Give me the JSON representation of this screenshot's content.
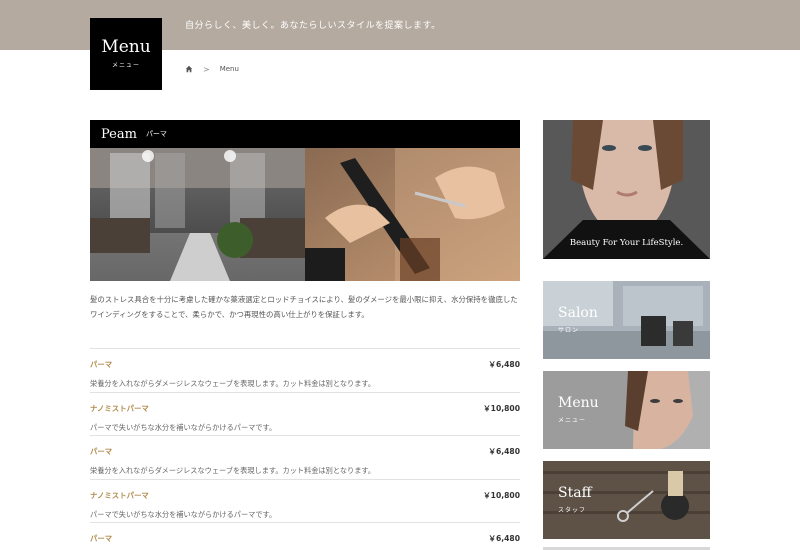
{
  "header": {
    "tagline": "自分らしく、美しく。あなたらしいスタイルを提案します。",
    "logo_main": "Menu",
    "logo_sub": "メニュー"
  },
  "breadcrumb": {
    "current": "Menu",
    "separator": ">",
    "home_icon": "home-icon"
  },
  "section": {
    "title": "Peam",
    "subtitle": "パーマ",
    "intro": "髪のストレス具合を十分に考慮した確かな薬液選定とロッドチョイスにより、髪のダメージを最小限に抑え、水分保持を徹底したワインディングをすることで、柔らかで、かつ再現性の高い仕上がりを保証します。"
  },
  "menu_items": [
    {
      "name": "パーマ",
      "price": "￥6,480",
      "desc": "栄養分を入れながらダメージレスなウェーブを表現します。カット料金は別となります。"
    },
    {
      "name": "ナノミストパーマ",
      "price": "￥10,800",
      "desc": "パーマで失いがちな水分を補いながらかけるパーマです。"
    },
    {
      "name": "パーマ",
      "price": "￥6,480",
      "desc": "栄養分を入れながらダメージレスなウェーブを表現します。カット料金は別となります。"
    },
    {
      "name": "ナノミストパーマ",
      "price": "￥10,800",
      "desc": "パーマで失いがちな水分を補いながらかけるパーマです。"
    },
    {
      "name": "パーマ",
      "price": "￥6,480",
      "desc": ""
    }
  ],
  "sidebar": {
    "beauty_caption": "Beauty For Your LifeStyle.",
    "salon_title": "Salon",
    "salon_sub": "サロン",
    "menu_title": "Menu",
    "menu_sub": "メニュー",
    "staff_title": "Staff",
    "staff_sub": "スタッフ"
  },
  "colors": {
    "topbar": "#b5aa9f",
    "accent": "#b08a4b",
    "logo_bg": "#000000"
  }
}
